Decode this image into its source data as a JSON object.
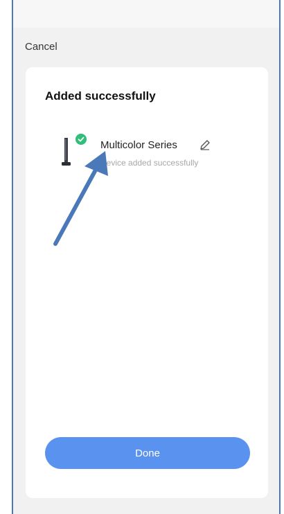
{
  "header": {
    "cancel_label": "Cancel"
  },
  "card": {
    "title": "Added successfully"
  },
  "device": {
    "name": "Multicolor Series",
    "status": "Device added successfully",
    "image_icon": "device-icon",
    "badge_icon": "check-circle-icon",
    "edit_icon": "pencil-icon"
  },
  "footer": {
    "done_label": "Done"
  },
  "colors": {
    "accent": "#5a93ef",
    "success": "#2fbf7a",
    "annotation_arrow": "#4a78b8"
  }
}
